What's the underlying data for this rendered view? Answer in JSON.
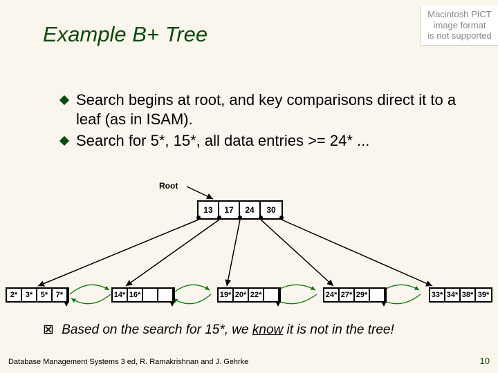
{
  "title": "Example B+ Tree",
  "pictBox": {
    "l1": "Macintosh PICT",
    "l2": "image format",
    "l3": "is not supported"
  },
  "bullets": [
    "Search begins at root, and key comparisons direct it to a leaf (as in ISAM).",
    "Search for 5*, 15*, all data entries >= 24* ..."
  ],
  "rootLabel": "Root",
  "rootKeys": [
    "13",
    "17",
    "24",
    "30"
  ],
  "leaves": [
    [
      "2*",
      "3*",
      "5*",
      "7*"
    ],
    [
      "14*",
      "16*",
      "",
      ""
    ],
    [
      "19*",
      "20*",
      "22*",
      ""
    ],
    [
      "24*",
      "27*",
      "29*",
      ""
    ],
    [
      "33*",
      "34*",
      "38*",
      "39*"
    ]
  ],
  "conclusion": {
    "prefix": "Based on the search for 15*, we ",
    "underlined": "know",
    "suffix": " it is not in the tree!"
  },
  "footer": {
    "left": "Database Management Systems 3 ed,  R. Ramakrishnan and J. Gehrke",
    "right": "10"
  },
  "chart_data": {
    "type": "diagram",
    "structure": "B+ tree",
    "root": {
      "keys": [
        13,
        17,
        24,
        30
      ]
    },
    "leaves": [
      [
        2,
        3,
        5,
        7
      ],
      [
        14,
        16
      ],
      [
        19,
        20,
        22
      ],
      [
        24,
        27,
        29
      ],
      [
        33,
        34,
        38,
        39
      ]
    ],
    "note": "leaf entries shown with * suffix indicating data-record pointers"
  }
}
